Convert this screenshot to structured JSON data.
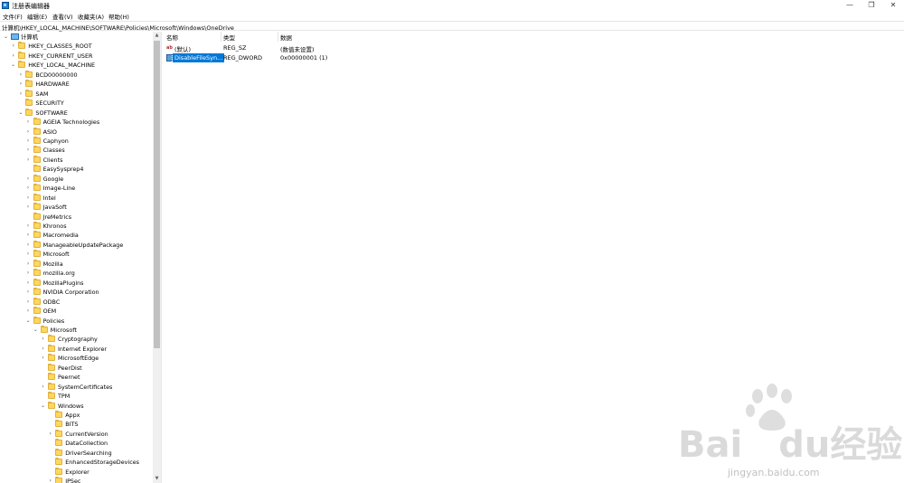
{
  "window": {
    "title": "注册表编辑器",
    "minimize": "—",
    "restore": "❐",
    "close": "✕"
  },
  "menu": [
    "文件(F)",
    "编辑(E)",
    "查看(V)",
    "收藏夹(A)",
    "帮助(H)"
  ],
  "address": "计算机\\HKEY_LOCAL_MACHINE\\SOFTWARE\\Policies\\Microsoft\\Windows\\OneDrive",
  "tree": [
    {
      "label": "计算机",
      "level": 0,
      "expand": "open",
      "icon": "computer-icon"
    },
    {
      "label": "HKEY_CLASSES_ROOT",
      "level": 1,
      "expand": "closed"
    },
    {
      "label": "HKEY_CURRENT_USER",
      "level": 1,
      "expand": "closed"
    },
    {
      "label": "HKEY_LOCAL_MACHINE",
      "level": 1,
      "expand": "open"
    },
    {
      "label": "BCD00000000",
      "level": 2,
      "expand": "closed"
    },
    {
      "label": "HARDWARE",
      "level": 2,
      "expand": "closed"
    },
    {
      "label": "SAM",
      "level": 2,
      "expand": "closed"
    },
    {
      "label": "SECURITY",
      "level": 2,
      "expand": "none"
    },
    {
      "label": "SOFTWARE",
      "level": 2,
      "expand": "open"
    },
    {
      "label": "AGEIA Technologies",
      "level": 3,
      "expand": "closed"
    },
    {
      "label": "ASIO",
      "level": 3,
      "expand": "closed"
    },
    {
      "label": "Caphyon",
      "level": 3,
      "expand": "closed"
    },
    {
      "label": "Classes",
      "level": 3,
      "expand": "closed"
    },
    {
      "label": "Clients",
      "level": 3,
      "expand": "closed"
    },
    {
      "label": "EasySysprep4",
      "level": 3,
      "expand": "none"
    },
    {
      "label": "Google",
      "level": 3,
      "expand": "closed"
    },
    {
      "label": "Image-Line",
      "level": 3,
      "expand": "closed"
    },
    {
      "label": "Intel",
      "level": 3,
      "expand": "closed"
    },
    {
      "label": "JavaSoft",
      "level": 3,
      "expand": "closed"
    },
    {
      "label": "JreMetrics",
      "level": 3,
      "expand": "none"
    },
    {
      "label": "Khronos",
      "level": 3,
      "expand": "closed"
    },
    {
      "label": "Macromedia",
      "level": 3,
      "expand": "closed"
    },
    {
      "label": "ManageableUpdatePackage",
      "level": 3,
      "expand": "closed"
    },
    {
      "label": "Microsoft",
      "level": 3,
      "expand": "closed"
    },
    {
      "label": "Mozilla",
      "level": 3,
      "expand": "closed"
    },
    {
      "label": "mozilla.org",
      "level": 3,
      "expand": "closed"
    },
    {
      "label": "MozillaPlugins",
      "level": 3,
      "expand": "closed"
    },
    {
      "label": "NVIDIA Corporation",
      "level": 3,
      "expand": "closed"
    },
    {
      "label": "ODBC",
      "level": 3,
      "expand": "closed"
    },
    {
      "label": "OEM",
      "level": 3,
      "expand": "closed"
    },
    {
      "label": "Policies",
      "level": 3,
      "expand": "open"
    },
    {
      "label": "Microsoft",
      "level": 4,
      "expand": "open"
    },
    {
      "label": "Cryptography",
      "level": 5,
      "expand": "closed"
    },
    {
      "label": "Internet Explorer",
      "level": 5,
      "expand": "closed"
    },
    {
      "label": "MicrosoftEdge",
      "level": 5,
      "expand": "closed"
    },
    {
      "label": "PeerDist",
      "level": 5,
      "expand": "none"
    },
    {
      "label": "Peernet",
      "level": 5,
      "expand": "none"
    },
    {
      "label": "SystemCertificates",
      "level": 5,
      "expand": "closed"
    },
    {
      "label": "TPM",
      "level": 5,
      "expand": "none"
    },
    {
      "label": "Windows",
      "level": 5,
      "expand": "open"
    },
    {
      "label": "Appx",
      "level": 6,
      "expand": "none"
    },
    {
      "label": "BITS",
      "level": 6,
      "expand": "none"
    },
    {
      "label": "CurrentVersion",
      "level": 6,
      "expand": "closed"
    },
    {
      "label": "DataCollection",
      "level": 6,
      "expand": "none"
    },
    {
      "label": "DriverSearching",
      "level": 6,
      "expand": "none"
    },
    {
      "label": "EnhancedStorageDevices",
      "level": 6,
      "expand": "none"
    },
    {
      "label": "Explorer",
      "level": 6,
      "expand": "none"
    },
    {
      "label": "IPSec",
      "level": 6,
      "expand": "closed"
    }
  ],
  "columns": {
    "name": "名称",
    "type": "类型",
    "data": "数据"
  },
  "values": [
    {
      "name": "(默认)",
      "type": "REG_SZ",
      "data": "(数值未设置)",
      "icon": "string-value-icon",
      "selected": false
    },
    {
      "name": "DisableFileSyn...",
      "type": "REG_DWORD",
      "data": "0x00000001 (1)",
      "icon": "dword-value-icon",
      "selected": true
    }
  ],
  "watermark": {
    "brand": "Bai",
    "brand2": "du",
    "cn": "经验",
    "url": "jingyan.baidu.com"
  }
}
